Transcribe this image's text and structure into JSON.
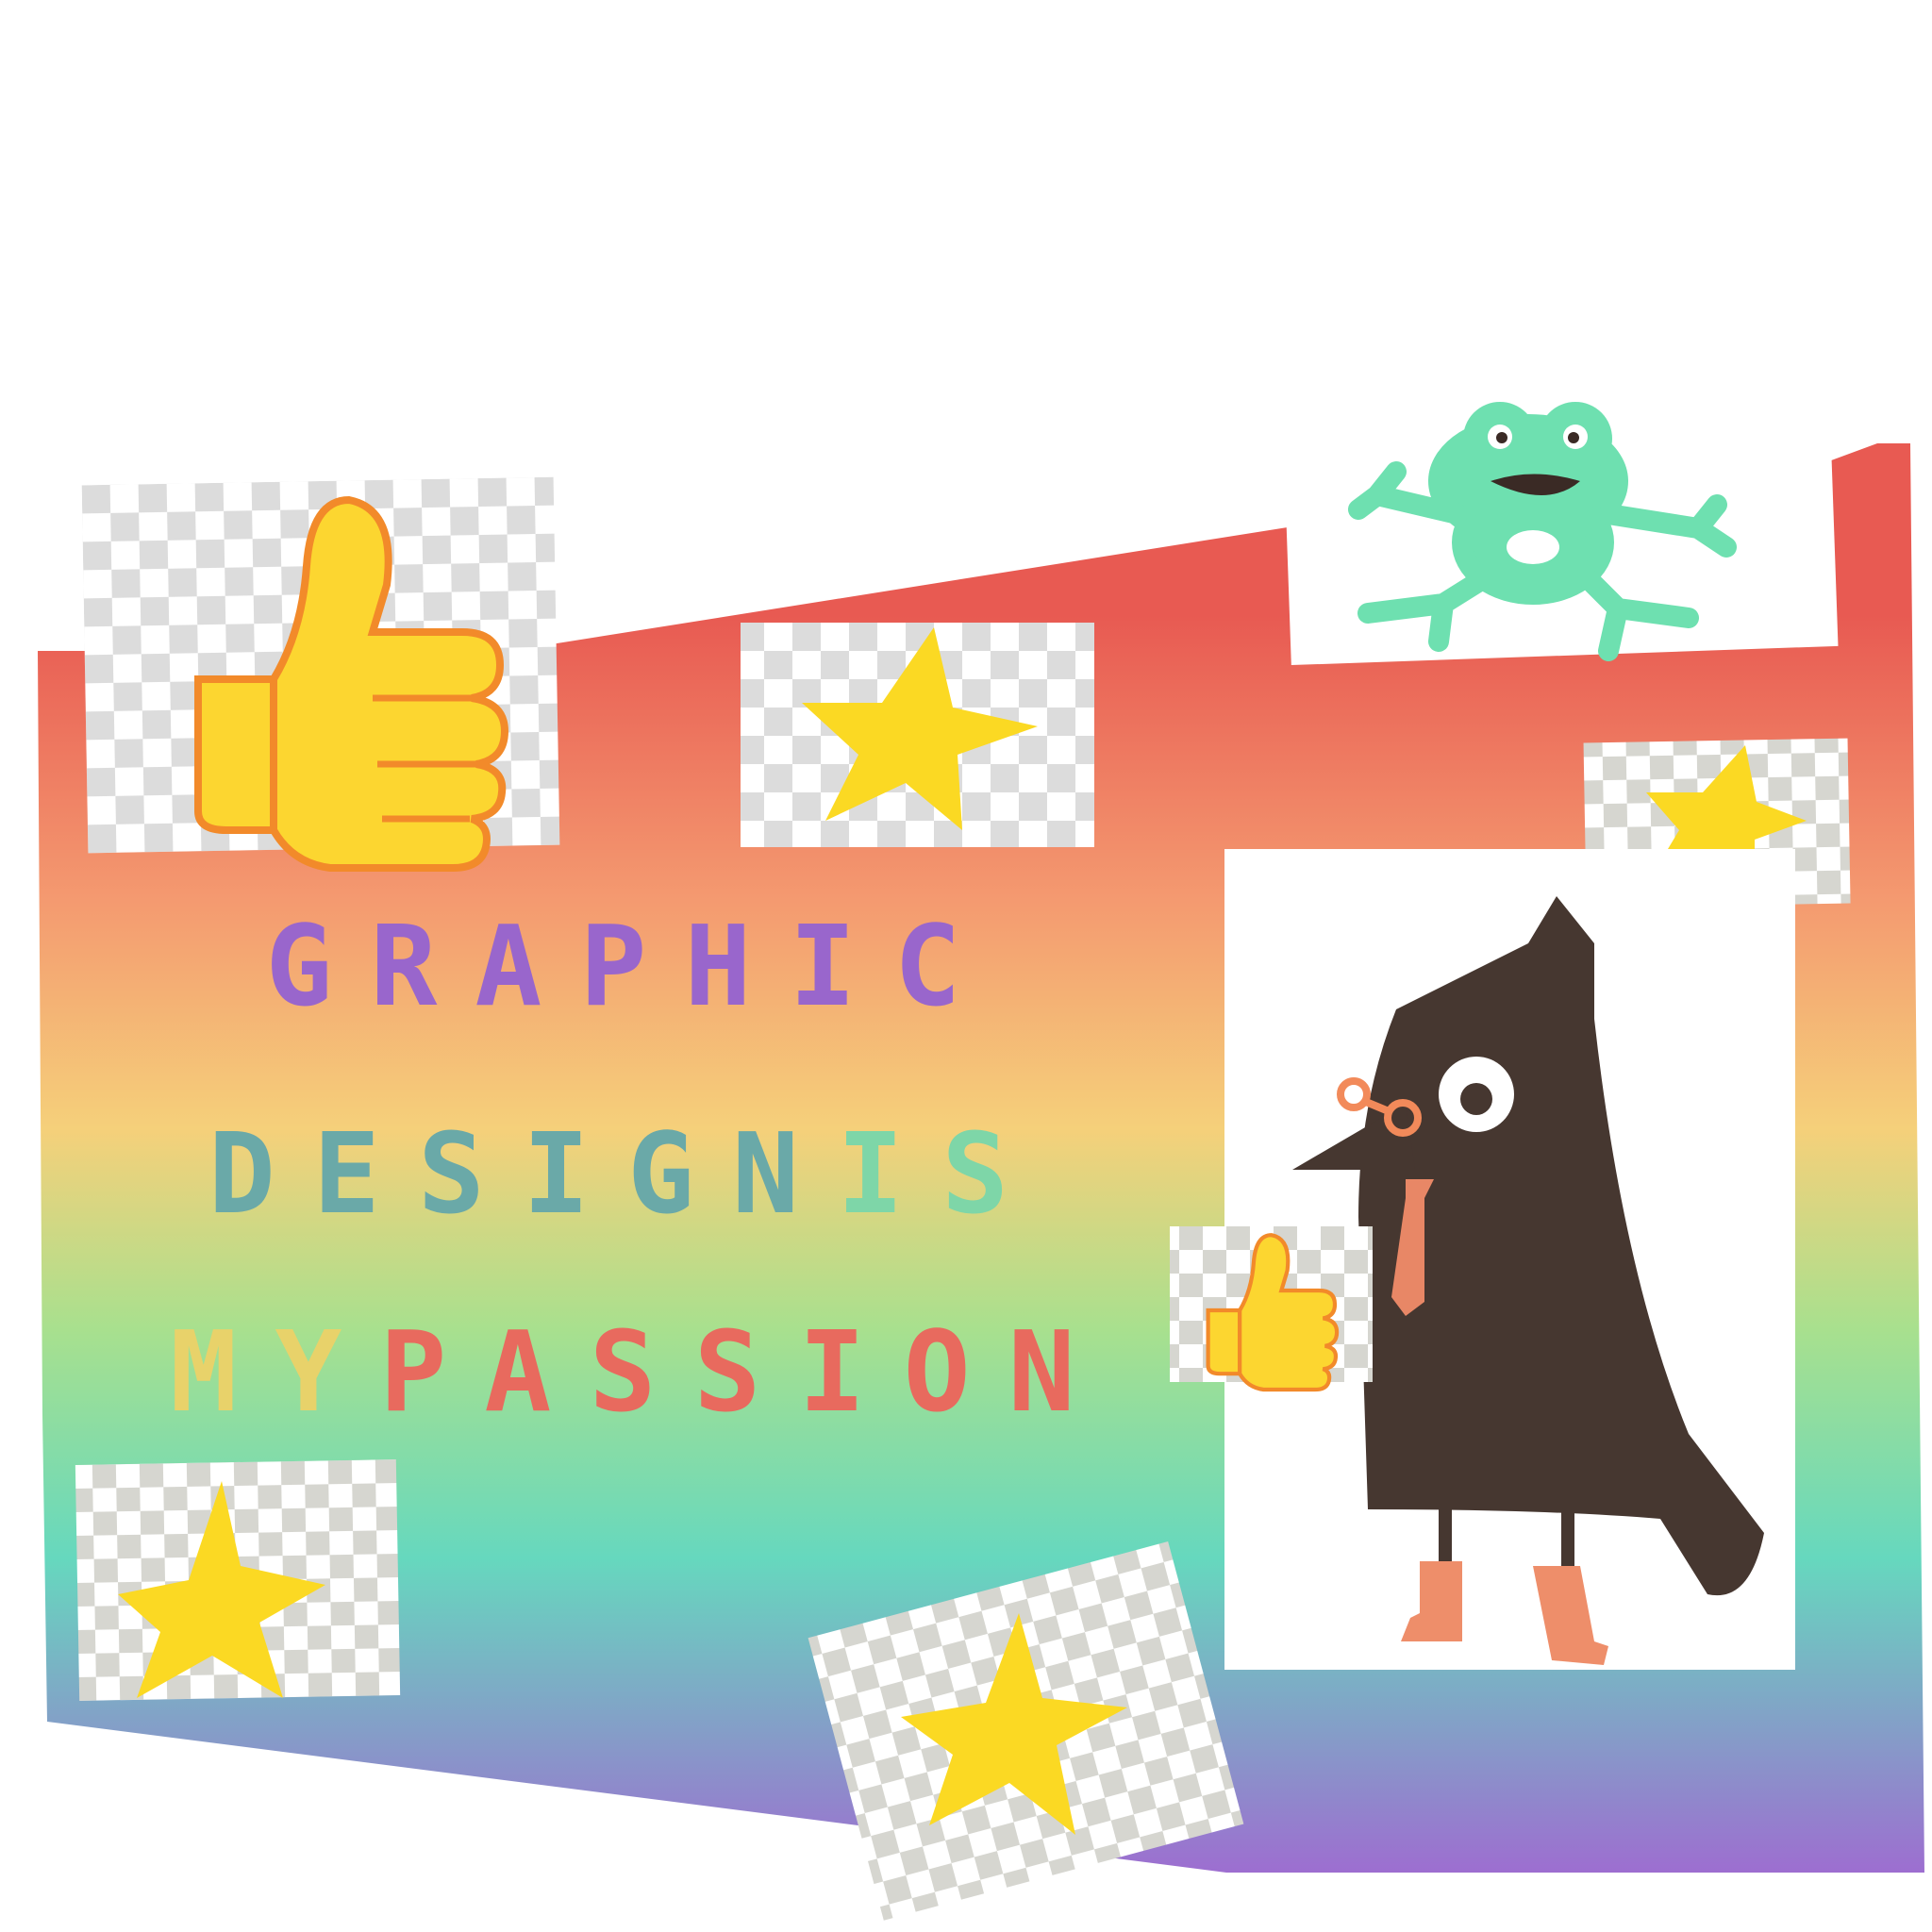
{
  "poster": {
    "line1": [
      {
        "text": "GRAPHIC",
        "color": "#9966cc"
      }
    ],
    "line2": [
      {
        "text": "DESIGN ",
        "color": "#6aa9a8"
      },
      {
        "text": "IS",
        "color": "#7ed6a8"
      }
    ],
    "line3": [
      {
        "text": "MY ",
        "color": "#e8d26a"
      },
      {
        "text": "PASSION",
        "color": "#e86a5e"
      }
    ]
  },
  "colors": {
    "gradient": [
      "#e85a52",
      "#f49a70",
      "#f5d07a",
      "#a8e08e",
      "#66d8be",
      "#9d6ed0"
    ],
    "checker": "#dcdcdc",
    "star": "#fbd923",
    "thumb": "#fcd630",
    "thumb_outline": "#f28a2a",
    "frog": "#6ee0b0",
    "bird": "#463730",
    "tie": "#e88766",
    "boots": "#ee8e6a"
  },
  "icons": [
    "thumbs-up-icon",
    "star-icon",
    "frog-icon",
    "bird-character"
  ]
}
